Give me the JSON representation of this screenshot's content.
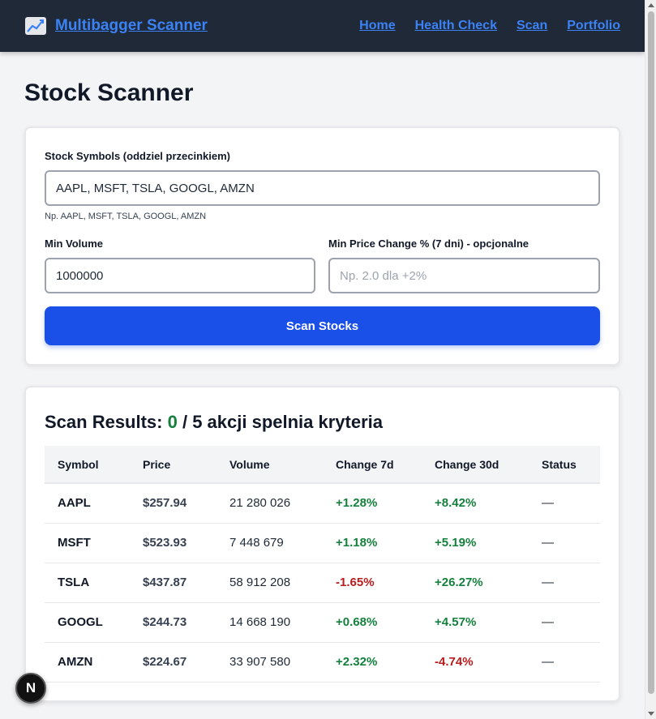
{
  "navbar": {
    "brand": "Multibagger Scanner",
    "brand_icon": "chart-increasing-icon",
    "links": [
      "Home",
      "Health Check",
      "Scan",
      "Portfolio"
    ]
  },
  "page": {
    "title": "Stock Scanner"
  },
  "form": {
    "symbols_label": "Stock Symbols (oddziel przecinkiem)",
    "symbols_value": "AAPL, MSFT, TSLA, GOOGL, AMZN",
    "symbols_hint": "Np. AAPL, MSFT, TSLA, GOOGL, AMZN",
    "min_volume_label": "Min Volume",
    "min_volume_value": "1000000",
    "min_price_change_label": "Min Price Change % (7 dni) - opcjonalne",
    "min_price_change_placeholder": "Np. 2.0 dla +2%",
    "scan_button": "Scan Stocks"
  },
  "results": {
    "title_prefix": "Scan Results: ",
    "matched": "0",
    "title_suffix": " / 5 akcji spelnia kryteria",
    "columns": [
      "Symbol",
      "Price",
      "Volume",
      "Change 7d",
      "Change 30d",
      "Status"
    ],
    "rows": [
      {
        "symbol": "AAPL",
        "price": "$257.94",
        "volume": "21 280 026",
        "change7d": "+1.28%",
        "change30d": "+8.42%",
        "status": "—"
      },
      {
        "symbol": "MSFT",
        "price": "$523.93",
        "volume": "7 448 679",
        "change7d": "+1.18%",
        "change30d": "+5.19%",
        "status": "—"
      },
      {
        "symbol": "TSLA",
        "price": "$437.87",
        "volume": "58 912 208",
        "change7d": "-1.65%",
        "change30d": "+26.27%",
        "status": "—"
      },
      {
        "symbol": "GOOGL",
        "price": "$244.73",
        "volume": "14 668 190",
        "change7d": "+0.68%",
        "change30d": "+4.57%",
        "status": "—"
      },
      {
        "symbol": "AMZN",
        "price": "$224.67",
        "volume": "33 907 580",
        "change7d": "+2.32%",
        "change30d": "-4.74%",
        "status": "—"
      }
    ]
  },
  "badge": {
    "letter": "N"
  },
  "colors": {
    "navbar_bg": "#1f2937",
    "link": "#3b82f6",
    "button": "#1a4fe8",
    "positive": "#15803d",
    "negative": "#b91c1c"
  }
}
